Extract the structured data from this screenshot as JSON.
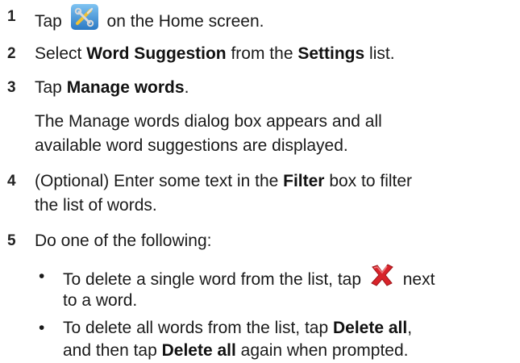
{
  "steps": [
    {
      "number": "1",
      "text_before": "Tap",
      "icon": "settings-tools-icon",
      "text_after": "on the Home screen."
    },
    {
      "number": "2",
      "parts": [
        "Select ",
        "Word Suggestion",
        " from the ",
        "Settings",
        " list."
      ]
    },
    {
      "number": "3",
      "parts": [
        "Tap ",
        "Manage words",
        "."
      ],
      "note_lines": [
        "The Manage words dialog box appears and all",
        "available word suggestions are displayed."
      ]
    },
    {
      "number": "4",
      "parts": [
        "(Optional) Enter some text in the ",
        "Filter",
        " box to filter"
      ],
      "line2": "the list of words."
    },
    {
      "number": "5",
      "text": "Do one of the following:",
      "bullets": [
        {
          "line1_before": "To delete a single word from the list, tap",
          "icon": "red-x-delete-icon",
          "line1_after": "next",
          "line2": "to a word."
        },
        {
          "line1_parts": [
            "To delete all words from the list, tap ",
            "Delete all",
            ","
          ],
          "line2_parts": [
            "and then tap ",
            "Delete all",
            " again when prompted."
          ]
        }
      ]
    }
  ],
  "colors": {
    "text": "#1a1a1a",
    "icon_blue": "#3a8fd6",
    "icon_red": "#d8232a"
  }
}
